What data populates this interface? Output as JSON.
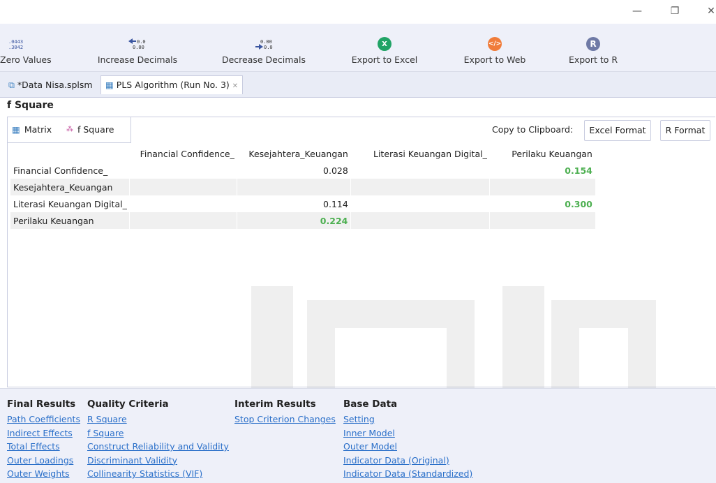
{
  "toolbar": {
    "items": [
      {
        "label": "Zero Values",
        "icon": "zero-values-icon"
      },
      {
        "label": "Increase Decimals",
        "icon": "increase-decimals-icon"
      },
      {
        "label": "Decrease Decimals",
        "icon": "decrease-decimals-icon"
      },
      {
        "label": "Export to Excel",
        "icon": "excel-icon",
        "color": "#21a366"
      },
      {
        "label": "Export to Web",
        "icon": "web-icon",
        "color": "#f07c3a"
      },
      {
        "label": "Export to R",
        "icon": "r-icon",
        "color": "#6f7aa6"
      }
    ]
  },
  "tabs": [
    {
      "label": "*Data Nisa.splsm"
    },
    {
      "label": "PLS Algorithm (Run No. 3)"
    }
  ],
  "section_title": "f Square",
  "subtabs": [
    {
      "label": "Matrix"
    },
    {
      "label": "f Square"
    }
  ],
  "copy": {
    "label": "Copy to Clipboard:",
    "excel": "Excel Format",
    "r": "R Format"
  },
  "matrix": {
    "columns": [
      "Financial Confidence_",
      "Kesejahtera_Keuangan",
      "Literasi Keuangan Digital_",
      "Perilaku Keuangan"
    ],
    "rows": [
      {
        "label": "Financial Confidence_",
        "cells": [
          "",
          "0.028",
          "",
          "0.154"
        ],
        "highlight": [
          false,
          false,
          false,
          true
        ]
      },
      {
        "label": "Kesejahtera_Keuangan",
        "cells": [
          "",
          "",
          "",
          ""
        ],
        "highlight": [
          false,
          false,
          false,
          false
        ]
      },
      {
        "label": "Literasi Keuangan Digital_",
        "cells": [
          "",
          "0.114",
          "",
          "0.300"
        ],
        "highlight": [
          false,
          false,
          false,
          true
        ]
      },
      {
        "label": "Perilaku Keuangan",
        "cells": [
          "",
          "0.224",
          "",
          ""
        ],
        "highlight": [
          false,
          true,
          false,
          false
        ]
      }
    ],
    "highlight_color": "#4caf50"
  },
  "footer": {
    "final_results": {
      "heading": "Final Results",
      "links": [
        "Path Coefficients",
        "Indirect Effects",
        "Total Effects",
        "Outer Loadings",
        "Outer Weights"
      ]
    },
    "quality_criteria": {
      "heading": "Quality Criteria",
      "links": [
        "R Square",
        "f Square",
        "Construct Reliability and Validity",
        "Discriminant Validity",
        "Collinearity Statistics (VIF)"
      ]
    },
    "interim_results": {
      "heading": "Interim Results",
      "links": [
        "Stop Criterion Changes"
      ]
    },
    "base_data": {
      "heading": "Base Data",
      "links": [
        "Setting",
        "Inner Model",
        "Outer Model",
        "Indicator Data (Original)",
        "Indicator Data (Standardized)"
      ]
    }
  }
}
